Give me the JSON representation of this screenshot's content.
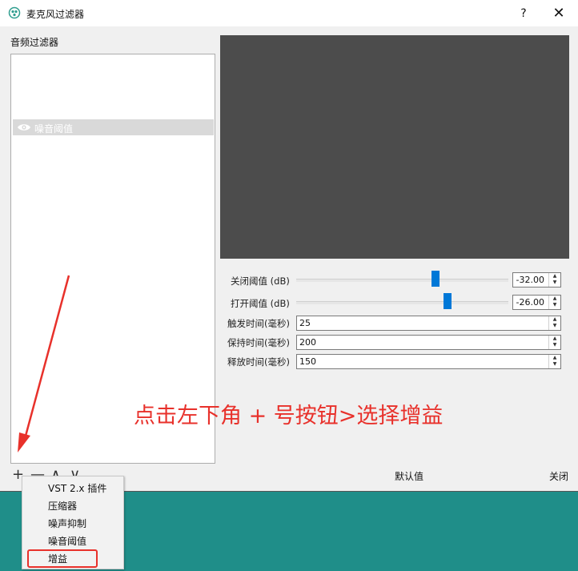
{
  "window": {
    "title": "麦克风过滤器",
    "help_label": "?",
    "close_label": "✕"
  },
  "filters": {
    "section_label": "音频过滤器",
    "items": [
      {
        "label": "噪音阈值",
        "visible": true
      }
    ]
  },
  "properties": {
    "close_threshold": {
      "label": "关闭阈值 (dB)",
      "value": "-32.00",
      "slider_fraction": 0.64
    },
    "open_threshold": {
      "label": "打开阈值 (dB)",
      "value": "-26.00",
      "slider_fraction": 0.7
    },
    "attack_time": {
      "label": "触发时间(毫秒)",
      "value": "25"
    },
    "hold_time": {
      "label": "保持时间(毫秒)",
      "value": "200"
    },
    "release_time": {
      "label": "释放时间(毫秒)",
      "value": "150"
    }
  },
  "toolbar": {
    "add": "+",
    "remove": "—",
    "up": "∧",
    "down": "∨"
  },
  "buttons": {
    "defaults": "默认值",
    "close": "关闭"
  },
  "annotation": {
    "text": "点击左下角 + 号按钮>选择增益",
    "color": "#e8312b"
  },
  "menu": {
    "items": [
      "VST 2.x 插件",
      "压缩器",
      "噪声抑制",
      "噪音阈值",
      "增益"
    ],
    "highlighted": "增益"
  },
  "colors": {
    "accent": "#0078d7",
    "preview_bg": "#4c4c4c",
    "desktop": "#1f8e89"
  }
}
